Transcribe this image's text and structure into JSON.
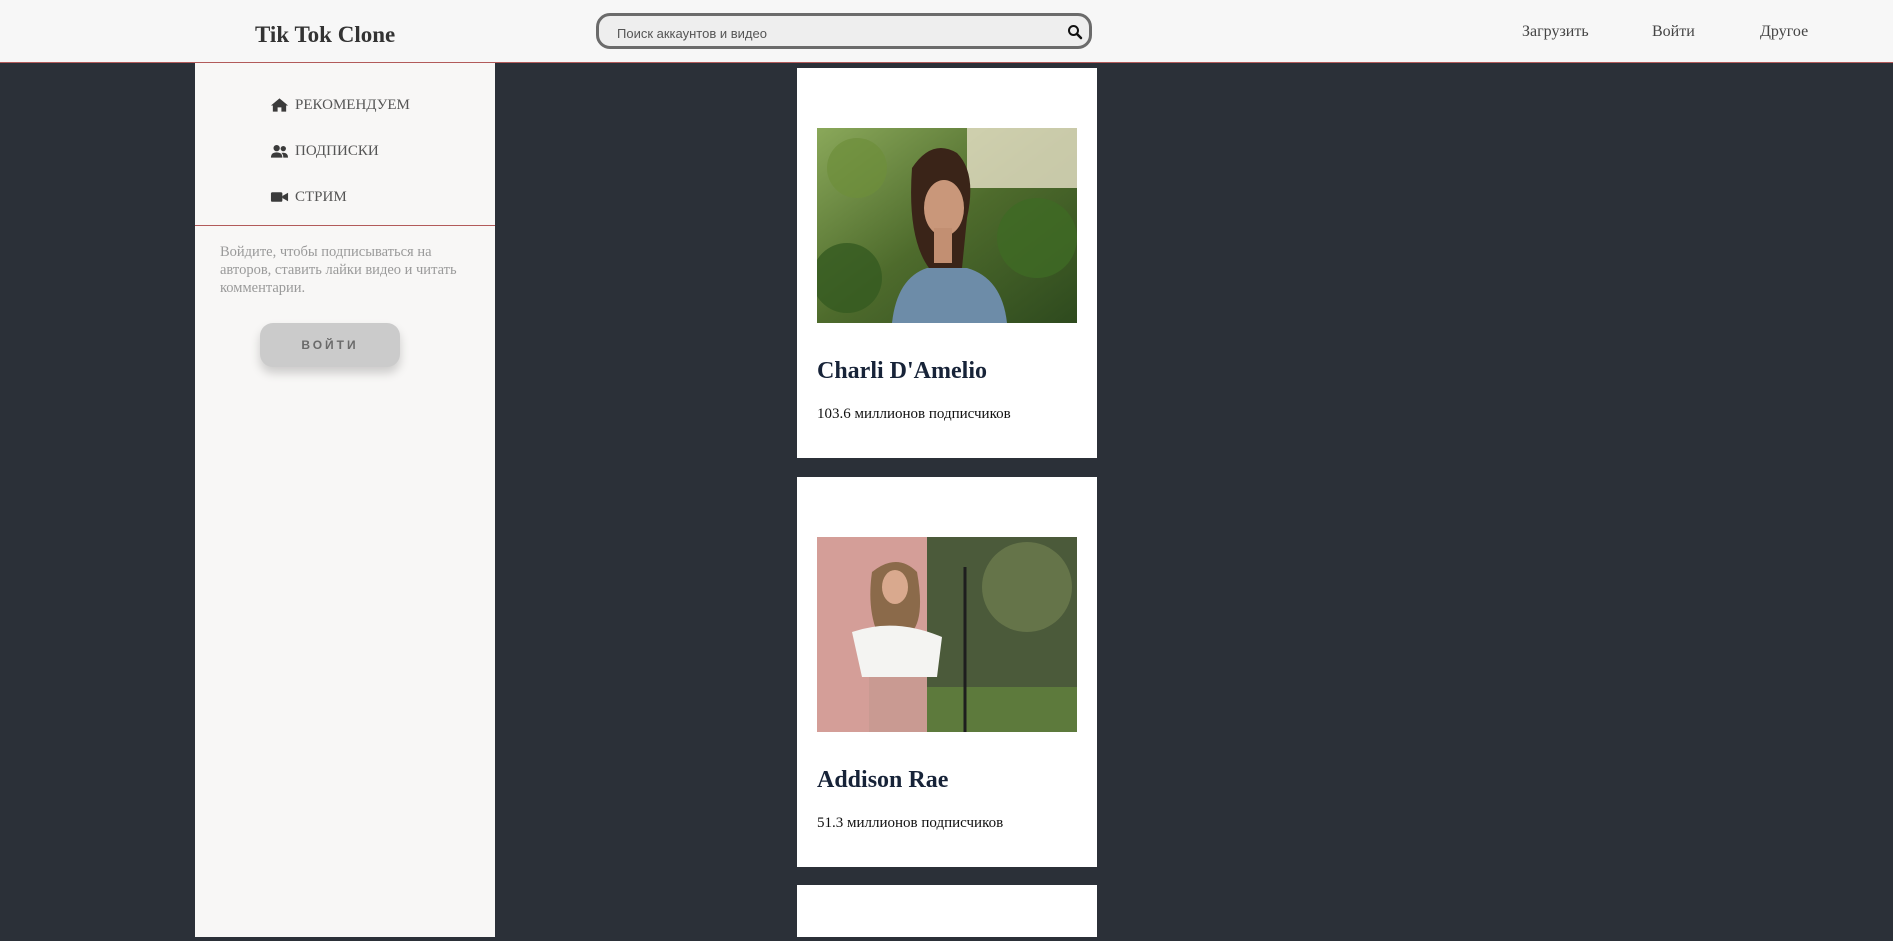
{
  "header": {
    "logo": "Tik Tok Clone",
    "search_placeholder": "Поиск аккаунтов и видео",
    "nav": [
      "Загрузить",
      "Войти",
      "Другое"
    ]
  },
  "sidebar": {
    "items": [
      {
        "label": "РЕКОМЕНДУЕМ",
        "icon": "home-icon"
      },
      {
        "label": "ПОДПИСКИ",
        "icon": "users-icon"
      },
      {
        "label": "СТРИМ",
        "icon": "video-camera-icon"
      }
    ],
    "note": "Войдите, чтобы подписываться на авторов, ставить лайки видео и читать комментарии.",
    "login_button": "ВОЙТИ"
  },
  "feed": {
    "cards": [
      {
        "name": "Charli D'Amelio",
        "followers": "103.6 миллионов подписчиков"
      },
      {
        "name": "Addison Rae",
        "followers": "51.3 миллионов подписчиков"
      }
    ]
  },
  "colors": {
    "background": "#2b3038",
    "header": "#f7f7f7",
    "accent_line": "#b25a5a",
    "name_text": "#172338"
  }
}
